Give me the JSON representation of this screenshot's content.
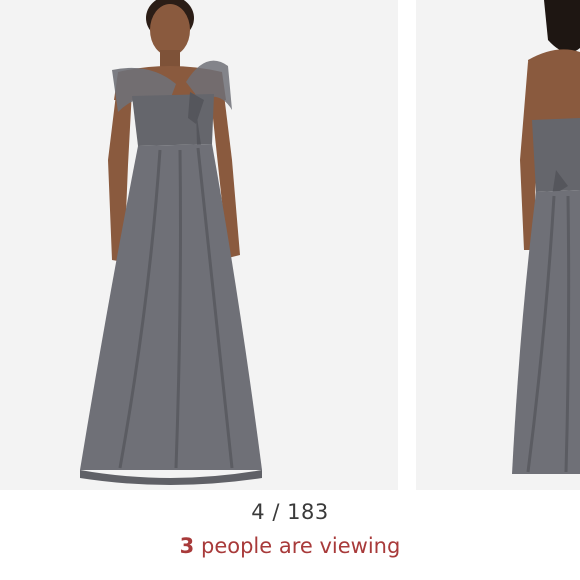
{
  "gallery": {
    "current_index": "4",
    "separator": "/",
    "total": "183",
    "viewing_count": "3",
    "viewing_text": "people are viewing",
    "photos": [
      {
        "icon": "dress-front-photo"
      },
      {
        "icon": "dress-back-photo"
      }
    ]
  },
  "colors": {
    "dress": "#6f7077",
    "dress_shadow": "#55565c",
    "skin": "#8a5a3e",
    "background": "#f3f3f3",
    "viewing_accent": "#a83a3a",
    "counter_text": "#3a3a3a"
  }
}
